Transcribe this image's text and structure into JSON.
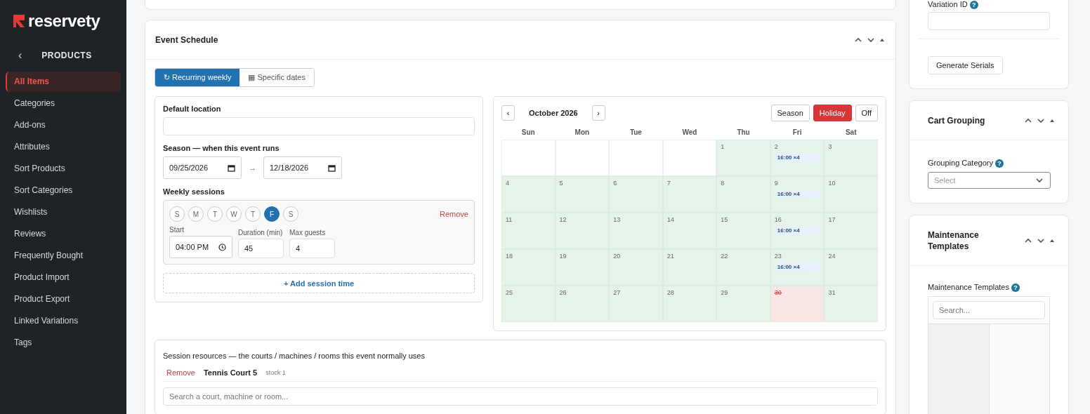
{
  "brand": {
    "name": "reservety"
  },
  "sidebar": {
    "back": "‹",
    "section": "PRODUCTS",
    "items": [
      {
        "label": "All Items",
        "selected": true
      },
      {
        "label": "Categories",
        "selected": false
      },
      {
        "label": "Add-ons",
        "selected": false
      },
      {
        "label": "Attributes",
        "selected": false
      },
      {
        "label": "Sort Products",
        "selected": false
      },
      {
        "label": "Sort Categories",
        "selected": false
      },
      {
        "label": "Wishlists",
        "selected": false
      },
      {
        "label": "Reviews",
        "selected": false
      },
      {
        "label": "Frequently Bought",
        "selected": false
      },
      {
        "label": "Product Import",
        "selected": false
      },
      {
        "label": "Product Export",
        "selected": false
      },
      {
        "label": "Linked Variations",
        "selected": false
      },
      {
        "label": "Tags",
        "selected": false
      }
    ]
  },
  "event_schedule": {
    "title": "Event Schedule",
    "modes": [
      {
        "label": "↻ Recurring weekly",
        "selected": true
      },
      {
        "label": "▦ Specific dates",
        "selected": false
      }
    ],
    "default_location": {
      "label": "Default location"
    },
    "season": {
      "label": "Season — when this event runs",
      "start": "09/25/2026",
      "arrow": "→",
      "end": "12/18/2026"
    },
    "weekly_sessions": {
      "label": "Weekly sessions",
      "remove": "Remove",
      "days": [
        {
          "label": "S",
          "selected": false
        },
        {
          "label": "M",
          "selected": false
        },
        {
          "label": "T",
          "selected": false
        },
        {
          "label": "W",
          "selected": false
        },
        {
          "label": "T",
          "selected": false
        },
        {
          "label": "F",
          "selected": true
        },
        {
          "label": "S",
          "selected": false
        }
      ],
      "start": {
        "label": "Start",
        "value": "04:00 PM"
      },
      "duration": {
        "label": "Duration (min)",
        "value": "45"
      },
      "max_guests": {
        "label": "Max guests",
        "value": "4"
      },
      "add": "+ Add session time"
    },
    "calendar": {
      "prev": "‹",
      "month": "October 2026",
      "next": "›",
      "modes": [
        {
          "label": "Season",
          "selected": false
        },
        {
          "label": "Holiday",
          "selected": true
        },
        {
          "label": "Off",
          "selected": false
        }
      ],
      "weekdays": [
        "Sun",
        "Mon",
        "Tue",
        "Wed",
        "Thu",
        "Fri",
        "Sat"
      ],
      "cells": [
        {
          "kind": "blank"
        },
        {
          "kind": "blank"
        },
        {
          "kind": "blank"
        },
        {
          "kind": "blank"
        },
        {
          "kind": "season",
          "day": "1"
        },
        {
          "kind": "season",
          "day": "2",
          "session": "16:00 ×4"
        },
        {
          "kind": "season",
          "day": "3"
        },
        {
          "kind": "season",
          "day": "4"
        },
        {
          "kind": "season",
          "day": "5"
        },
        {
          "kind": "season",
          "day": "6"
        },
        {
          "kind": "season",
          "day": "7"
        },
        {
          "kind": "season",
          "day": "8"
        },
        {
          "kind": "season",
          "day": "9",
          "session": "16:00 ×4"
        },
        {
          "kind": "season",
          "day": "10"
        },
        {
          "kind": "season",
          "day": "11"
        },
        {
          "kind": "season",
          "day": "12"
        },
        {
          "kind": "season",
          "day": "13"
        },
        {
          "kind": "season",
          "day": "14"
        },
        {
          "kind": "season",
          "day": "15"
        },
        {
          "kind": "season",
          "day": "16",
          "session": "16:00 ×4"
        },
        {
          "kind": "season",
          "day": "17"
        },
        {
          "kind": "season",
          "day": "18"
        },
        {
          "kind": "season",
          "day": "19"
        },
        {
          "kind": "season",
          "day": "20"
        },
        {
          "kind": "season",
          "day": "21"
        },
        {
          "kind": "season",
          "day": "22"
        },
        {
          "kind": "season",
          "day": "23",
          "session": "16:00 ×4"
        },
        {
          "kind": "season",
          "day": "24"
        },
        {
          "kind": "season",
          "day": "25"
        },
        {
          "kind": "season",
          "day": "26"
        },
        {
          "kind": "season",
          "day": "27"
        },
        {
          "kind": "season",
          "day": "28"
        },
        {
          "kind": "season",
          "day": "29"
        },
        {
          "kind": "holiday",
          "day": "30"
        },
        {
          "kind": "season",
          "day": "31"
        }
      ]
    },
    "resources": {
      "title": "Session resources — the courts / machines / rooms this event normally uses",
      "items": [
        {
          "remove": "Remove",
          "name": "Tennis Court 5",
          "stock": "stock 1"
        }
      ],
      "search_placeholder": "Search a court, machine or room..."
    }
  },
  "right": {
    "variation_id": {
      "label": "Variation ID",
      "help": "?"
    },
    "generate": "Generate Serials",
    "cart_grouping": {
      "title": "Cart Grouping",
      "field": "Grouping Category",
      "help": "?",
      "placeholder": "Select"
    },
    "maintenance": {
      "title": "Maintenance Templates",
      "field": "Maintenance Templates",
      "help": "?",
      "search_placeholder": "Search..."
    }
  }
}
